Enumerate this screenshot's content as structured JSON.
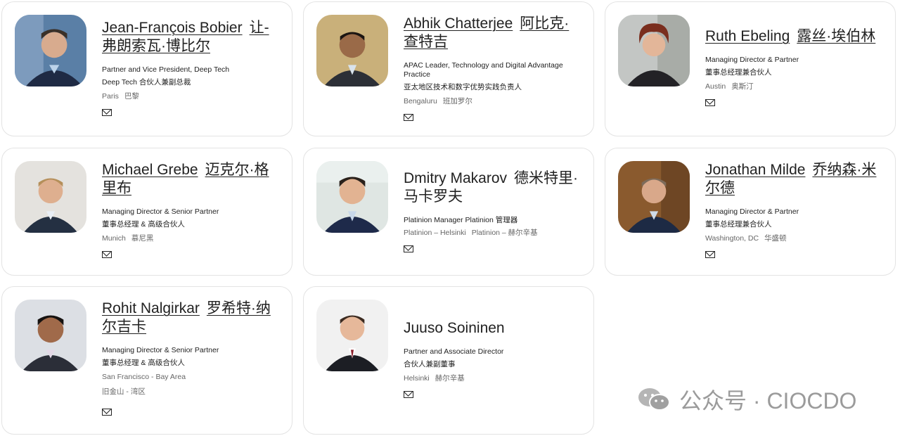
{
  "people": [
    {
      "name": "Jean-François Bobier",
      "name_cn": "让-弗朗索瓦·博比尔",
      "role": "Partner and Vice President, Deep Tech",
      "role_cn": "Deep Tech 合伙人兼副总裁",
      "loc": "Paris",
      "loc_cn": "巴黎"
    },
    {
      "name": "Abhik Chatterjee",
      "name_cn": "阿比克·查特吉",
      "role": "APAC Leader, Technology and Digital Advantage Practice",
      "role_cn": "亚太地区技术和数字优势实践负责人",
      "loc": "Bengaluru",
      "loc_cn": "班加罗尔"
    },
    {
      "name": "Ruth Ebeling",
      "name_cn": "露丝·埃伯林",
      "role": "Managing Director & Partner",
      "role_cn": "董事总经理兼合伙人",
      "loc": "Austin",
      "loc_cn": "奥斯汀"
    },
    {
      "name": "Michael Grebe",
      "name_cn": "迈克尔·格里布",
      "role": "Managing Director & Senior Partner",
      "role_cn": "董事总经理 & 高级合伙人",
      "loc": "Munich",
      "loc_cn": "慕尼黑"
    },
    {
      "name": "Dmitry Makarov",
      "name_cn": "德米特里·马卡罗夫",
      "role": "Platinion Manager   Platinion 管理器",
      "role_cn": "",
      "loc": "Platinion – Helsinki",
      "loc_cn": "Platinion – 赫尔辛基"
    },
    {
      "name": "Jonathan Milde",
      "name_cn": "乔纳森·米尔德",
      "role": "Managing Director & Partner",
      "role_cn": "董事总经理兼合伙人",
      "loc": "Washington, DC",
      "loc_cn": "华盛顿"
    },
    {
      "name": "Rohit Nalgirkar",
      "name_cn": "罗希特·纳尔吉卡",
      "role": "Managing Director & Senior Partner",
      "role_cn": "董事总经理 & 高级合伙人",
      "loc": "San Francisco - Bay Area",
      "loc_cn": "旧金山 - 湾区"
    },
    {
      "name": "Juuso Soininen",
      "name_cn": "",
      "role": "Partner and Associate Director",
      "role_cn": "合伙人兼副董事",
      "loc": "Helsinki",
      "loc_cn": "赫尔辛基"
    }
  ],
  "watermark": {
    "text": "公众号 · CIOCDO",
    "icon": "wechat-icon"
  }
}
